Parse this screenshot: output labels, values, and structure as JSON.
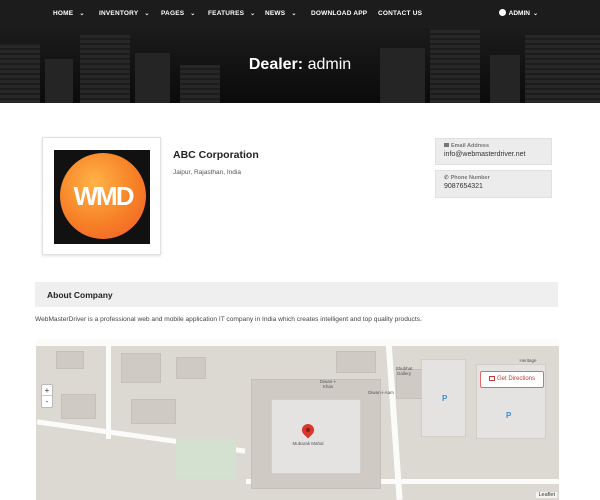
{
  "nav": {
    "items": [
      {
        "label": "HOME",
        "chevron": true
      },
      {
        "label": "INVENTORY",
        "chevron": true
      },
      {
        "label": "PAGES",
        "chevron": true
      },
      {
        "label": "FEATURES",
        "chevron": true
      },
      {
        "label": "NEWS",
        "chevron": true
      },
      {
        "label": "DOWNLOAD APP",
        "chevron": false
      },
      {
        "label": "CONTACT US",
        "chevron": false
      }
    ],
    "user_label": "ADMIN",
    "user_icon": "user-icon"
  },
  "hero": {
    "title_prefix": "Dealer:",
    "title_name": "admin"
  },
  "dealer": {
    "logo_text": "WMD",
    "name": "ABC Corporation",
    "location": "Jaipur, Rajasthan, India",
    "email_label": "Email Address",
    "email": "info@webmasterdriver.net",
    "phone_label": "Phone Number",
    "phone": "9087654321"
  },
  "about": {
    "title": "About Company",
    "text": "WebMasterDriver is a professional web and mobile application IT company in India which creates intelligent and top quality products."
  },
  "map": {
    "zoom_in": "+",
    "zoom_out": "-",
    "directions_label": "Get Directions",
    "attribution": "Leaflet",
    "labels": [
      "Diwan-i-Khas",
      "Shubhat Gallery",
      "Diwan-i-Aam",
      "Mubarak Mahal",
      "Heritage"
    ],
    "parking_symbol": "P"
  },
  "colors": {
    "nav_bg": "#1c1c1c",
    "logo_orange": "#f77f26",
    "directions_red": "#c73a3a",
    "pin_red": "#d9352b"
  }
}
